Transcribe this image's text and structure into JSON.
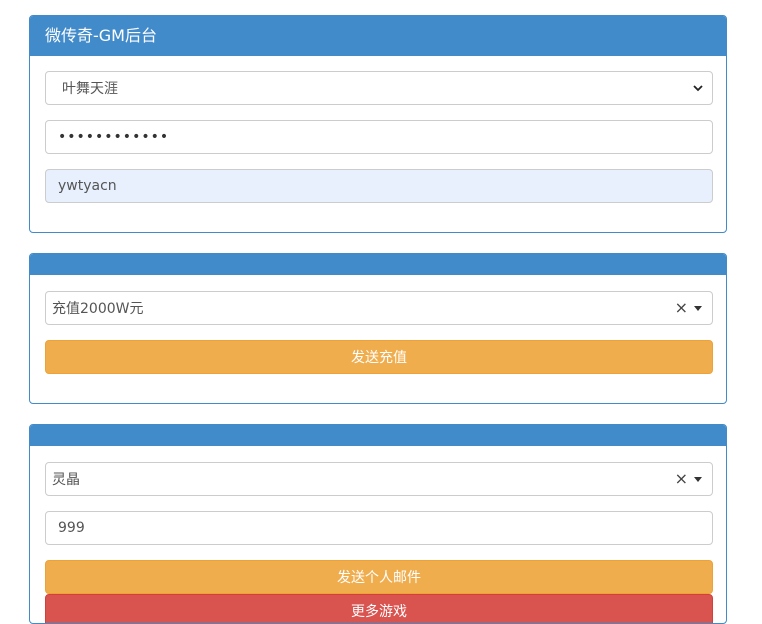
{
  "panel1": {
    "title": "微传奇-GM后台",
    "server_select": "叶舞天涯",
    "password_mask": "••••••••••••",
    "username": "ywtyacn"
  },
  "panel2": {
    "title": "",
    "recharge_select": "充值2000W元",
    "send_recharge_label": "发送充值"
  },
  "panel3": {
    "title": "",
    "item_select": "灵晶",
    "quantity": "999",
    "send_mail_label": "发送个人邮件",
    "more_games_label": "更多游戏"
  },
  "icons": {
    "select_chevron": "chevron-down-icon",
    "clear": "clear-icon",
    "caret": "caret-down-icon"
  },
  "colors": {
    "primary": "#428bca",
    "warning": "#f0ad4e",
    "danger": "#d9534f",
    "autofill": "#e8f0fe"
  }
}
